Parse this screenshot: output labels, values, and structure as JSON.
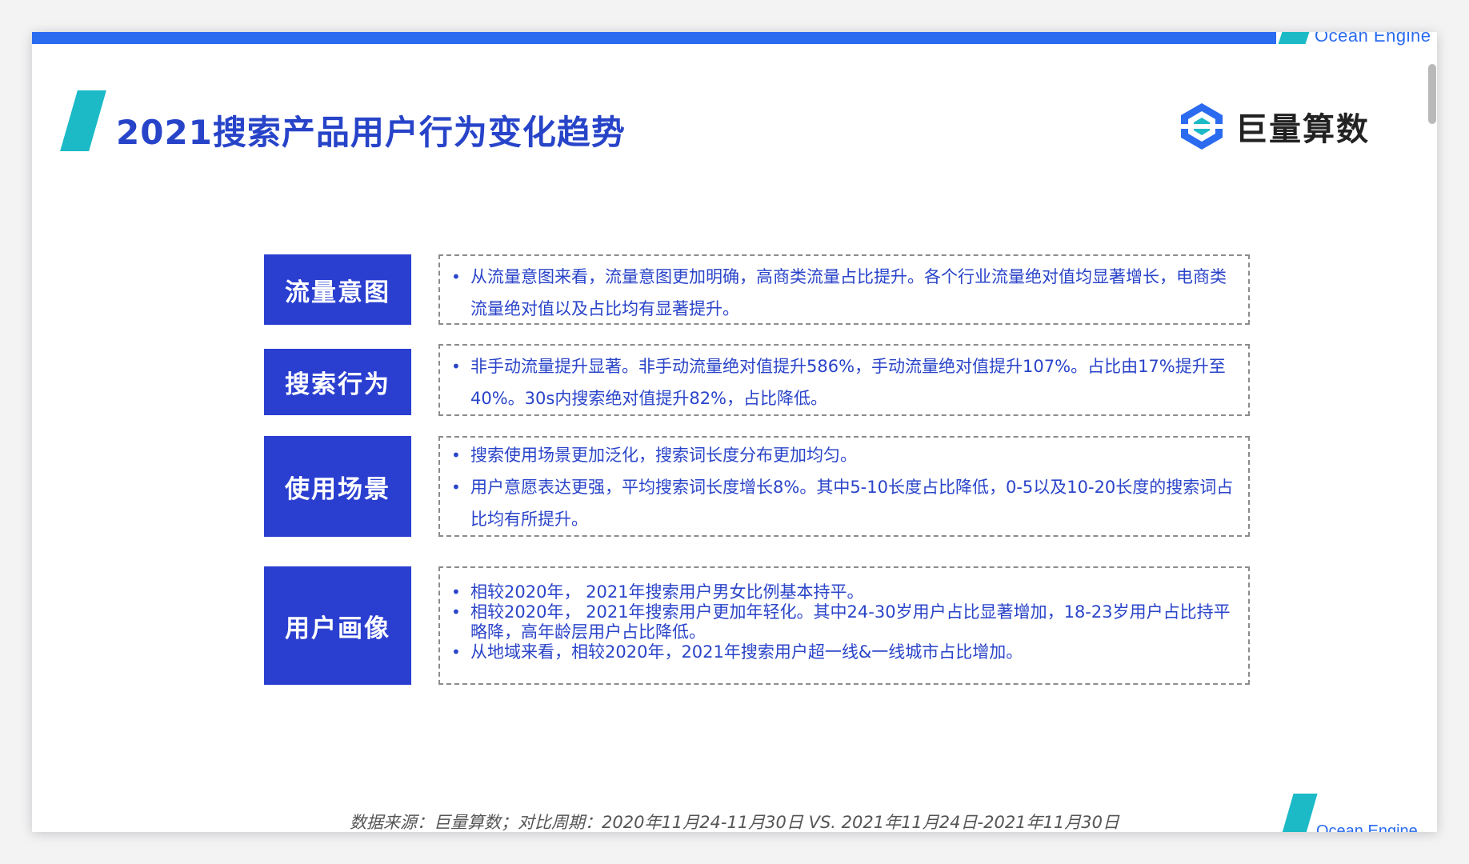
{
  "header": {
    "brand_top": "Ocean Engine",
    "title": "2021搜索产品用户行为变化趋势",
    "logo_text": "巨量算数"
  },
  "sections": [
    {
      "label": "流量意图",
      "bullets": [
        "从流量意图来看，流量意图更加明确，高商类流量占比提升。各个行业流量绝对值均显著增长，电商类流量绝对值以及占比均有显著提升。"
      ]
    },
    {
      "label": "搜索行为",
      "bullets": [
        "非手动流量提升显著。非手动流量绝对值提升586%，手动流量绝对值提升107%。占比由17%提升至40%。30s内搜索绝对值提升82%，占比降低。"
      ]
    },
    {
      "label": "使用场景",
      "bullets": [
        "搜索使用场景更加泛化，搜索词长度分布更加均匀。",
        "用户意愿表达更强，平均搜索词长度增长8%。其中5-10长度占比降低，0-5以及10-20长度的搜索词占比均有所提升。"
      ]
    },
    {
      "label": "用户画像",
      "bullets": [
        "相较2020年， 2021年搜索用户男女比例基本持平。",
        "相较2020年， 2021年搜索用户更加年轻化。其中24-30岁用户占比显著增加，18-23岁用户占比持平略降，高年龄层用户占比降低。",
        "从地域来看，相较2020年，2021年搜索用户超一线&一线城市占比增加。"
      ]
    }
  ],
  "footer": {
    "source": "数据来源：巨量算数；对比周期：2020年11月24-11月30日 VS. 2021年11月24日-2021年11月30日",
    "brand_bottom": "Ocean Engine"
  },
  "colors": {
    "primary_blue": "#2a3fd0",
    "text_blue": "#2a44c9",
    "teal": "#1bbac6",
    "bar_blue": "#2a6bf0"
  }
}
